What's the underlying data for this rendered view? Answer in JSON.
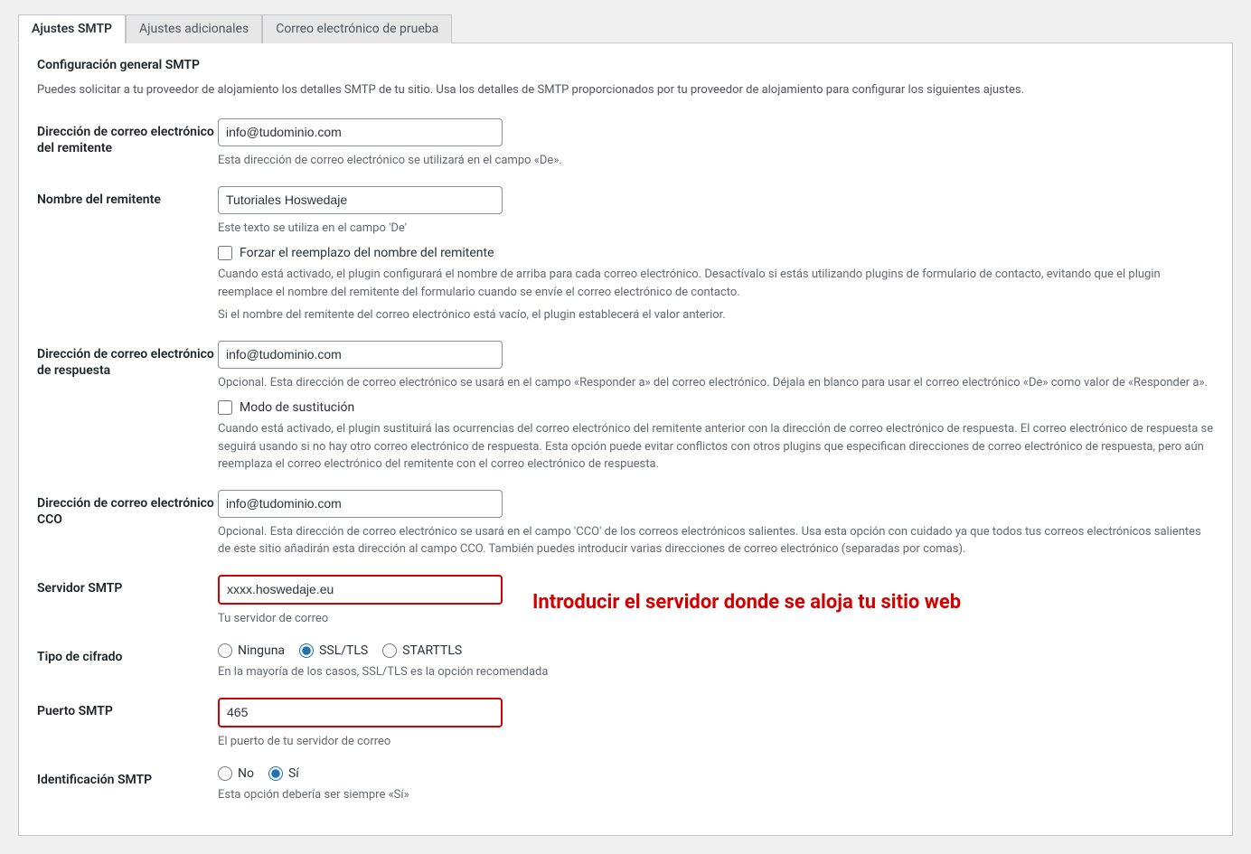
{
  "tabs": {
    "smtp": "Ajustes SMTP",
    "additional": "Ajustes adicionales",
    "test": "Correo electrónico de prueba"
  },
  "section": {
    "title": "Configuración general SMTP",
    "intro": "Puedes solicitar a tu proveedor de alojamiento los detalles SMTP de tu sitio. Usa los detalles de SMTP proporcionados por tu proveedor de alojamiento para configurar los siguientes ajustes."
  },
  "fields": {
    "from_email": {
      "label": "Dirección de correo electrónico del remitente",
      "value": "info@tudominio.com",
      "help": "Esta dirección de correo electrónico se utilizará en el campo «De»."
    },
    "from_name": {
      "label": "Nombre del remitente",
      "value": "Tutoriales Hoswedaje",
      "help": "Este texto se utiliza en el campo 'De'",
      "checkbox_label": "Forzar el reemplazo del nombre del remitente",
      "checkbox_help1": "Cuando está activado, el plugin configurará el nombre de arriba para cada correo electrónico. Desactívalo si estás utilizando plugins de formulario de contacto, evitando que el plugin reemplace el nombre del remitente del formulario cuando se envíe el correo electrónico de contacto.",
      "checkbox_help2": "Si el nombre del remitente del correo electrónico está vacío, el plugin establecerá el valor anterior."
    },
    "reply_email": {
      "label": "Dirección de correo electrónico de respuesta",
      "value": "info@tudominio.com",
      "help": "Opcional. Esta dirección de correo electrónico se usará en el campo «Responder a» del correo electrónico. Déjala en blanco para usar el correo electrónico «De» como valor de «Responder a».",
      "checkbox_label": "Modo de sustitución",
      "checkbox_help": "Cuando está activado, el plugin sustituirá las ocurrencias del correo electrónico del remitente anterior con la dirección de correo electrónico de respuesta. El correo electrónico de respuesta se seguirá usando si no hay otro correo electrónico de respuesta. Esta opción puede evitar conflictos con otros plugins que especifican direcciones de correo electrónico de respuesta, pero aún reemplaza el correo electrónico del remitente con el correo electrónico de respuesta."
    },
    "bcc_email": {
      "label": "Dirección de correo electrónico CCO",
      "value": "info@tudominio.com",
      "help": "Opcional. Esta dirección de correo electrónico se usará en el campo 'CCO' de los correos electrónicos salientes. Usa esta opción con cuidado ya que todos tus correos electrónicos salientes de este sitio añadirán esta dirección al campo CCO. También puedes introducir varias direcciones de correo electrónico (separadas por comas)."
    },
    "smtp_server": {
      "label": "Servidor SMTP",
      "value": "xxxx.hoswedaje.eu",
      "help": "Tu servidor de correo",
      "annotation": "Introducir el servidor donde se aloja tu sitio web"
    },
    "encryption": {
      "label": "Tipo de cifrado",
      "option_none": "Ninguna",
      "option_ssl": "SSL/TLS",
      "option_starttls": "STARTTLS",
      "help": "En la mayoría de los casos, SSL/TLS es la opción recomendada"
    },
    "smtp_port": {
      "label": "Puerto SMTP",
      "value": "465",
      "help": "El puerto de tu servidor de correo"
    },
    "smtp_auth": {
      "label": "Identificación SMTP",
      "option_no": "No",
      "option_yes": "Sí",
      "help": "Esta opción debería ser siempre «Sí»"
    }
  }
}
